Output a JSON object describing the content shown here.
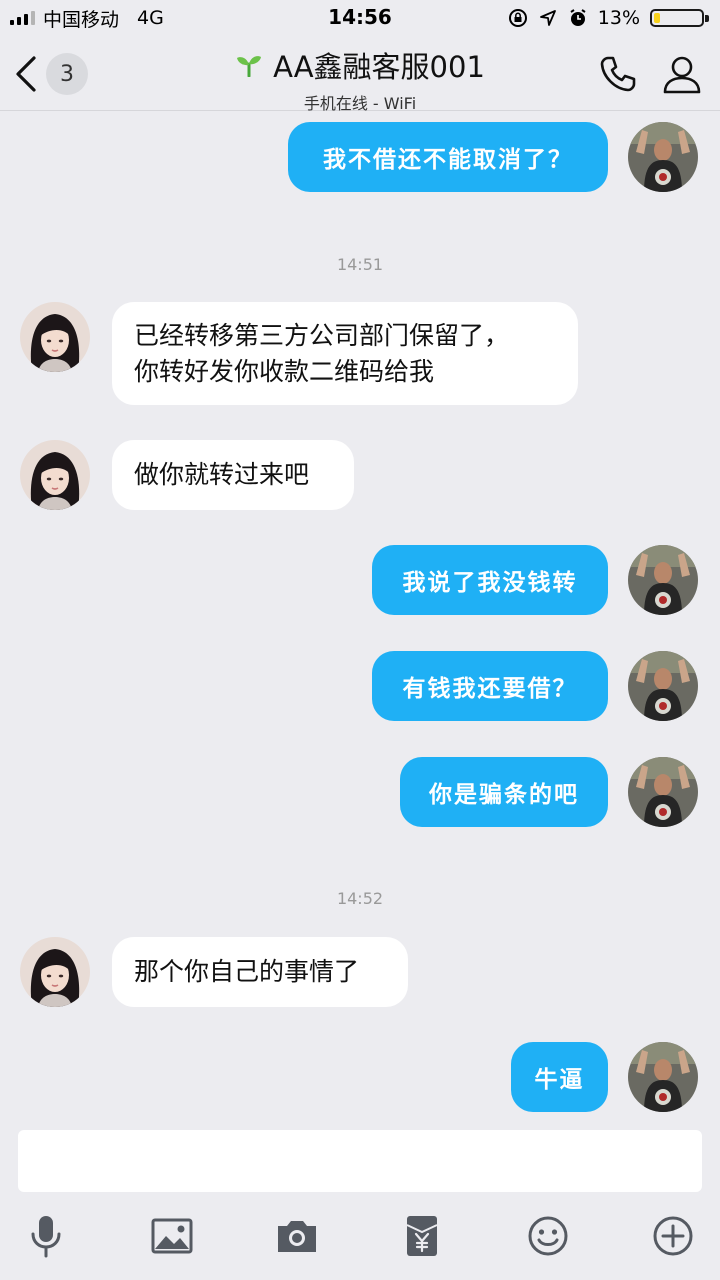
{
  "status_bar": {
    "carrier": "中国移动",
    "network": "4G",
    "time": "14:56",
    "battery_text": "13%",
    "battery_level": 0.13,
    "battery_color": "#f8d21c"
  },
  "header": {
    "back_badge": "3",
    "title": "AA鑫融客服001",
    "subtitle": "手机在线 - WiFi",
    "icons": [
      "back-chevron-icon",
      "sprout-icon",
      "phone-icon",
      "profile-icon"
    ]
  },
  "messages": [
    {
      "side": "out",
      "text": "我不借还不能取消了？"
    },
    {
      "timestamp": "14:51"
    },
    {
      "side": "in",
      "lines": [
        "已经转移第三方公司部门保留了，",
        "你转好发你收款二维码给我"
      ]
    },
    {
      "side": "in",
      "text": "做你就转过来吧"
    },
    {
      "side": "out",
      "text": "我说了我没钱转"
    },
    {
      "side": "out",
      "text": "有钱我还要借？"
    },
    {
      "side": "out",
      "text": "你是骗条的吧"
    },
    {
      "timestamp": "14:52"
    },
    {
      "side": "in",
      "text": "那个你自己的事情了"
    },
    {
      "side": "out",
      "text": "牛逼"
    }
  ],
  "input": {
    "placeholder": ""
  },
  "toolbar": {
    "icons": [
      "microphone-icon",
      "image-icon",
      "camera-icon",
      "red-packet-icon",
      "emoji-icon",
      "plus-icon"
    ]
  },
  "colors": {
    "background": "#ececf0",
    "outgoing_bubble": "#1fb0f5",
    "incoming_bubble": "#ffffff",
    "icon": "#555a62"
  }
}
